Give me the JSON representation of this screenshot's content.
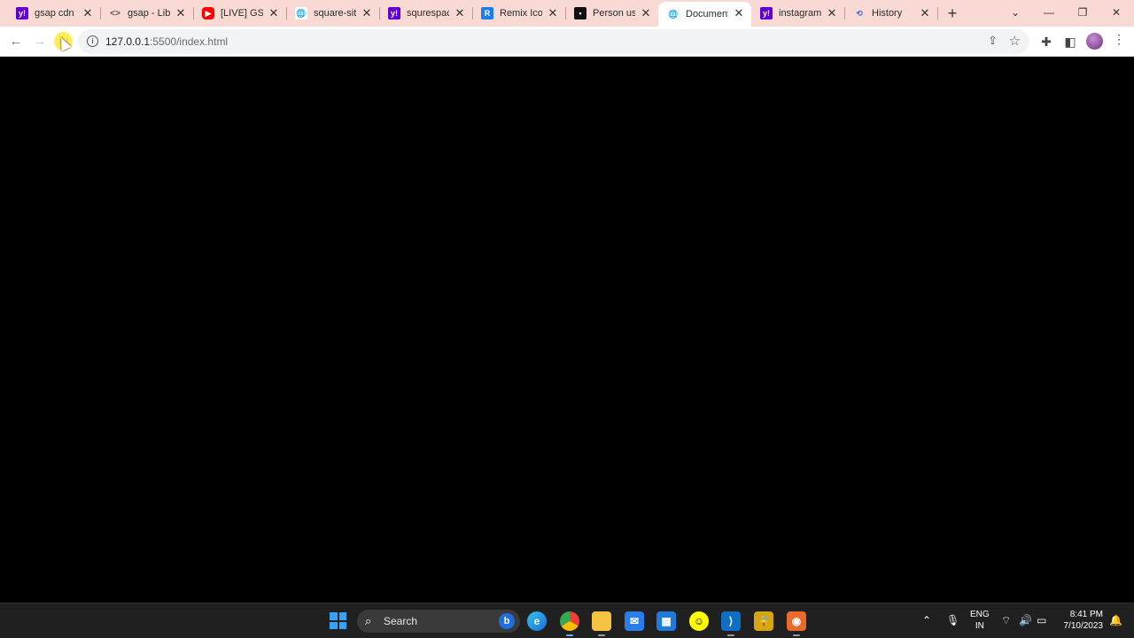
{
  "browser": {
    "tabs": [
      {
        "title": "gsap cdn -",
        "favicon": "yahoo-icon",
        "active": false
      },
      {
        "title": "gsap - Libra",
        "favicon": "code-icon",
        "active": false
      },
      {
        "title": "[LIVE] GSAP",
        "favicon": "youtube-icon",
        "active": false
      },
      {
        "title": "square-site",
        "favicon": "globe-icon",
        "active": false
      },
      {
        "title": "squrespace",
        "favicon": "yahoo-icon",
        "active": false
      },
      {
        "title": "Remix Icon",
        "favicon": "remix-icon",
        "active": false
      },
      {
        "title": "Person usin",
        "favicon": "unsplash-icon",
        "active": false
      },
      {
        "title": "Document",
        "favicon": "globe-icon",
        "active": true
      },
      {
        "title": "instagram",
        "favicon": "yahoo-icon",
        "active": false
      },
      {
        "title": "History",
        "favicon": "history-icon",
        "active": false
      }
    ],
    "address": {
      "host": "127.0.0.1",
      "path": ":5500/index.html"
    }
  },
  "taskbar": {
    "search_label": "Search",
    "language": "ENG",
    "region": "IN",
    "time": "8:41 PM",
    "date": "7/10/2023"
  }
}
